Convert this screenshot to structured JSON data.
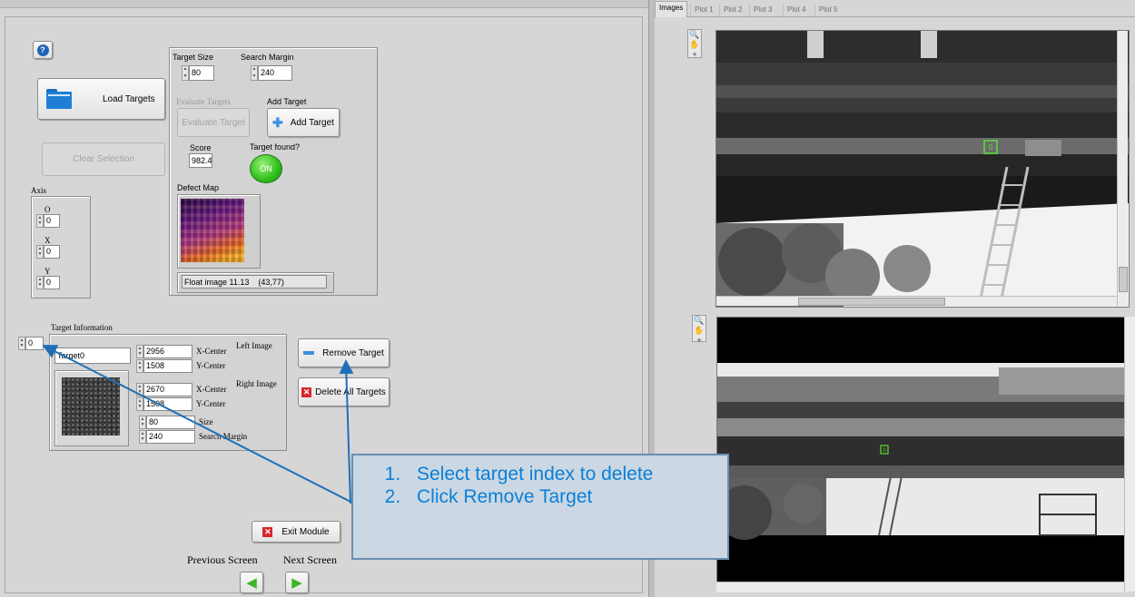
{
  "tabs": [
    "Images",
    "Plot 1",
    "Plot 2",
    "Plot 3",
    "Plot 4",
    "Plot 5"
  ],
  "help_icon": "help-icon",
  "load_targets": {
    "label": "Load Targets",
    "icon": "folder-icon"
  },
  "clear_selection": {
    "label": "Clear Selection"
  },
  "axis": {
    "title": "Axis",
    "fields": [
      {
        "label": "O",
        "value": "0"
      },
      {
        "label": "X",
        "value": "0"
      },
      {
        "label": "Y",
        "value": "0"
      }
    ]
  },
  "target_panel": {
    "target_size_label": "Target Size",
    "target_size_value": "80",
    "search_margin_label": "Search Margin",
    "search_margin_value": "240",
    "evaluate_targets_label": "Evaluate Targets",
    "evaluate_target_button": "Evaluate Target",
    "add_target_label": "Add Target",
    "add_target_button": "Add Target",
    "score_label": "Score",
    "score_value": "982.43",
    "target_found_label": "Target found?",
    "target_found_led": "ON",
    "defect_map_label": "Defect Map",
    "float_image_status": "Float image 11.13    (43,77)"
  },
  "target_info": {
    "title": "Target Information",
    "index_value": "0",
    "name": "Target0",
    "left_image_label": "Left Image",
    "right_image_label": "Right Image",
    "left_x_value": "2956",
    "left_x_label": "X-Center",
    "left_y_value": "1508",
    "left_y_label": "Y-Center",
    "right_x_value": "2670",
    "right_x_label": "X-Center",
    "right_y_value": "1508",
    "right_y_label": "Y-Center",
    "size_value": "80",
    "size_label": "Size",
    "search_margin_value": "240",
    "search_margin_label": "Search Margin"
  },
  "remove_target": {
    "label": "Remove Target"
  },
  "delete_all_targets": {
    "label": "Delete All Targets"
  },
  "exit_module": {
    "label": "Exit Module"
  },
  "nav": {
    "previous": "Previous Screen",
    "next": "Next Screen"
  },
  "callout": {
    "step1": "Select target index to delete",
    "step2": "Click Remove Target"
  },
  "top_image": {
    "marker_label": "0"
  },
  "bottom_image": {
    "marker_label": "0"
  },
  "colors": {
    "callout_text": "#0a80d8",
    "callout_bg": "#cbd7e2",
    "arrow": "#1f6fb8",
    "marker": "#5ddc3a",
    "led_on": "#3fcf2a"
  }
}
